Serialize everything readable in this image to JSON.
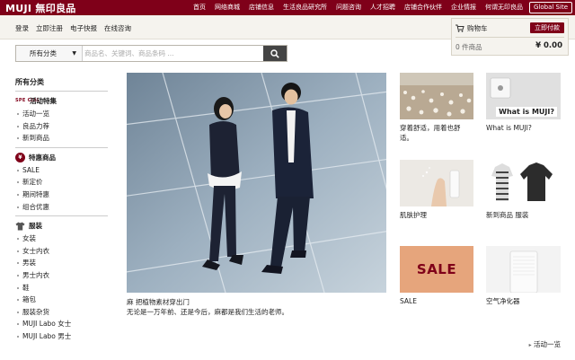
{
  "header": {
    "logo": "MUJI 無印良品",
    "nav": [
      "首页",
      "网络商城",
      "店铺信息",
      "生活良品研究所",
      "问题咨询",
      "人才招聘",
      "店铺合作伙伴",
      "企业情报",
      "何谓无印良品"
    ],
    "global_site": "Global Site"
  },
  "subbar": {
    "links": [
      "登录",
      "立即注册",
      "电子快报",
      "在线咨询"
    ]
  },
  "cart": {
    "label": "购物车",
    "pay_button": "立即付款",
    "count": "0 件商品",
    "total": "¥ 0.00"
  },
  "search": {
    "category": "所有分类",
    "placeholder": "商品名、关键词、商品条码 ..."
  },
  "sidebar": {
    "title": "所有分类",
    "special_icon": "SPE CIAL",
    "sections": [
      {
        "icon": "special-icon",
        "label": "活动特集",
        "items": [
          "活动一览",
          "良品力荐",
          "新到商品"
        ]
      },
      {
        "icon": "yen-icon",
        "label": "特惠商品",
        "items": [
          "SALE",
          "新定价",
          "期间特惠",
          "组合优惠"
        ]
      },
      {
        "icon": "shirt-icon",
        "label": "服装",
        "items": [
          "女装",
          "女士内衣",
          "男装",
          "男士内衣",
          "鞋",
          "箱包",
          "服装杂货",
          "MUJI Labo 女士",
          "MUJI Labo 男士"
        ]
      }
    ]
  },
  "hero": {
    "title": "麻 把植物素材穿出门",
    "subtitle": "无论是一万年前、还是今后，麻都是我们生活的老师。"
  },
  "tiles": [
    {
      "label": "穿着舒适，用着也舒适。"
    },
    {
      "label": "What is MUJI?",
      "image_text": "What is MUJI?"
    },
    {
      "label": "肌肤护理"
    },
    {
      "label": "新到商品 服装"
    },
    {
      "label": "SALE",
      "image_text": "SALE"
    },
    {
      "label": "空气净化器"
    }
  ],
  "more_link": "活动一览",
  "colors": {
    "brand": "#7f0019",
    "sale_bg": "#e6a57c",
    "sale_text": "#7f0019"
  }
}
